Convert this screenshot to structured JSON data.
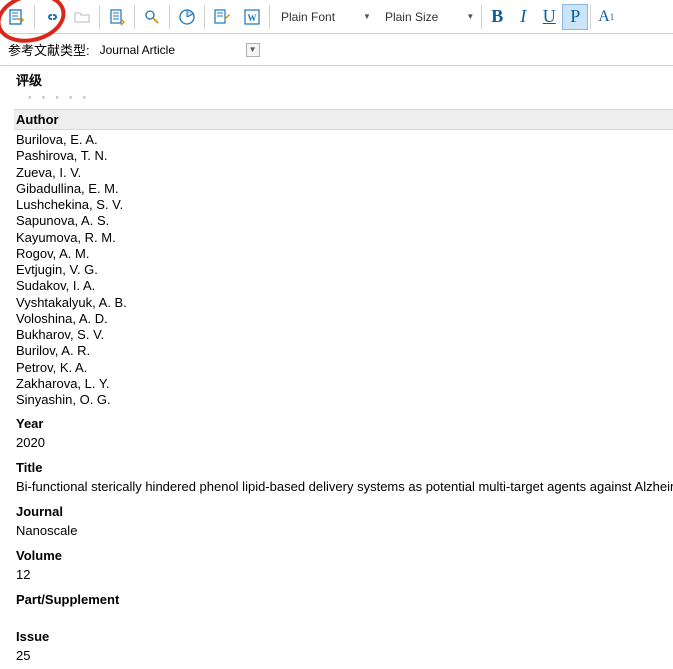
{
  "toolbar": {
    "font_select": "Plain Font",
    "size_select": "Plain Size",
    "bold": "B",
    "italic": "I",
    "underline": "U",
    "p": "P",
    "sup_a": "A",
    "sup_1": "1"
  },
  "reftype": {
    "label": "参考文献类型:",
    "value": "Journal Article"
  },
  "rating_label": "评级",
  "fields": {
    "author_label": "Author",
    "authors": [
      "Burilova, E. A.",
      "Pashirova, T. N.",
      "Zueva, I. V.",
      "Gibadullina, E. M.",
      "Lushchekina, S. V.",
      "Sapunova, A. S.",
      "Kayumova, R. M.",
      "Rogov, A. M.",
      "Evtjugin, V. G.",
      "Sudakov, I. A.",
      "Vyshtakalyuk, A. B.",
      "Voloshina, A. D.",
      "Bukharov, S. V.",
      "Burilov, A. R.",
      "Petrov, K. A.",
      "Zakharova, L. Y.",
      "Sinyashin, O. G."
    ],
    "year_label": "Year",
    "year": "2020",
    "title_label": "Title",
    "title": "Bi-functional sterically hindered phenol lipid-based delivery systems as potential multi-target agents against Alzheimer's dis",
    "journal_label": "Journal",
    "journal": "Nanoscale",
    "volume_label": "Volume",
    "volume": "12",
    "part_label": "Part/Supplement",
    "part": "",
    "issue_label": "Issue",
    "issue": "25"
  }
}
